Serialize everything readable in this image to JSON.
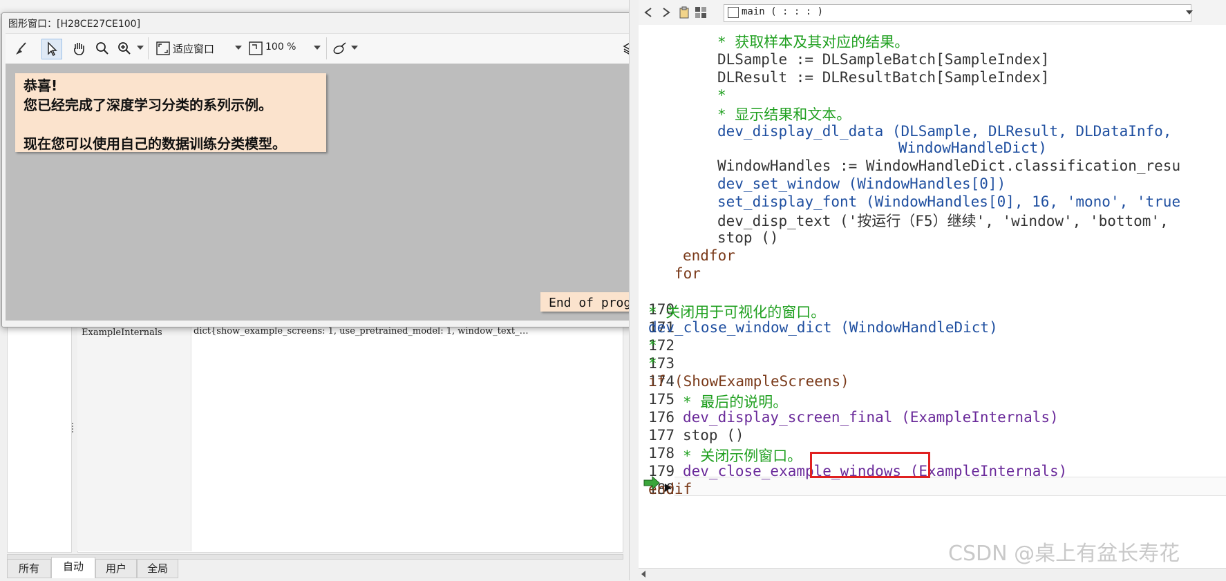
{
  "graphics_window": {
    "title": "图形窗口：[H28CE27CE100]",
    "toolbar": {
      "fit_label": "适应窗口",
      "zoom_value": "100 %"
    },
    "message": {
      "lines": [
        "恭喜!",
        "您已经完成了深度学习分类的系列示例。",
        "",
        "现在您可以使用自己的数据训练分类模型。"
      ]
    },
    "end_text": "End of program."
  },
  "variables": {
    "row": {
      "name": "ExampleInternals",
      "value": "dict{show_example_screens: 1, use_pretrained_model: 1, window_text_…"
    },
    "tabs": [
      "所有",
      "自动",
      "用户",
      "全局"
    ],
    "active_tab": "自动"
  },
  "editor": {
    "procedure": "main ( : : : )",
    "lines": [
      {
        "num": "",
        "indent": "",
        "text": "* 获取样本及其对应的结果。",
        "class": "c-green"
      },
      {
        "num": "",
        "indent": "",
        "text": "DLSample := DLSampleBatch[SampleIndex]",
        "class": "c-dark"
      },
      {
        "num": "",
        "indent": "",
        "text": "DLResult := DLResultBatch[SampleIndex]",
        "class": "c-dark"
      },
      {
        "num": "",
        "indent": "",
        "text": "*",
        "class": "c-green"
      },
      {
        "num": "",
        "indent": "",
        "text": "* 显示结果和文本。",
        "class": "c-green"
      },
      {
        "num": "",
        "indent": "",
        "text": "dev_display_dl_data (DLSample, DLResult, DLDataInfo, ",
        "class": "c-blue"
      },
      {
        "num": "",
        "indent": "",
        "text": "WindowHandleDict)",
        "class": "c-blue"
      },
      {
        "num": "",
        "indent": "",
        "text": "WindowHandles := WindowHandleDict.classification_resu",
        "class": "c-dark"
      },
      {
        "num": "",
        "indent": "",
        "text": "dev_set_window (WindowHandles[0])",
        "class": "c-blue"
      },
      {
        "num": "",
        "indent": "",
        "text": "set_display_font (WindowHandles[0], 16, 'mono', 'true",
        "class": "c-blue"
      },
      {
        "num": "",
        "indent": "",
        "text": "dev_disp_text ('按运行（F5）继续', 'window', 'bottom', ",
        "class": "c-dark"
      },
      {
        "num": "",
        "indent": "",
        "text": "stop ()",
        "class": "c-dark"
      },
      {
        "num": "",
        "indent": "",
        "text": "endfor",
        "class": "c-brown"
      },
      {
        "num": "",
        "indent": "",
        "text": "for",
        "class": "c-brown"
      },
      {
        "num": "170",
        "indent": "",
        "text": "* 关闭用于可视化的窗口。",
        "class": "c-green"
      },
      {
        "num": "171",
        "indent": "",
        "text": "dev_close_window_dict (WindowHandleDict)",
        "class": "c-blue"
      },
      {
        "num": "172",
        "indent": "",
        "text": "*",
        "class": "c-green"
      },
      {
        "num": "173",
        "indent": "",
        "text": "*",
        "class": "c-green"
      },
      {
        "num": "174",
        "indent": "",
        "text": "if (ShowExampleScreens)",
        "class": "c-brown"
      },
      {
        "num": "175",
        "indent": "",
        "text": "* 最后的说明。",
        "class": "c-green"
      },
      {
        "num": "176",
        "indent": "",
        "text": "dev_display_screen_final (ExampleInternals)",
        "class": "c-purple"
      },
      {
        "num": "177",
        "indent": "",
        "text": "stop ()",
        "class": "c-dark"
      },
      {
        "num": "178",
        "indent": "",
        "text": "* 关闭示例窗口。",
        "class": "c-green"
      },
      {
        "num": "179",
        "indent": "",
        "text": "dev_close_example_windows (ExampleInternals)",
        "class": "c-purple"
      },
      {
        "num": "180",
        "indent": "",
        "text": "endif",
        "class": "c-brown"
      }
    ]
  },
  "watermark": "CSDN @桌上有盆长寿花"
}
